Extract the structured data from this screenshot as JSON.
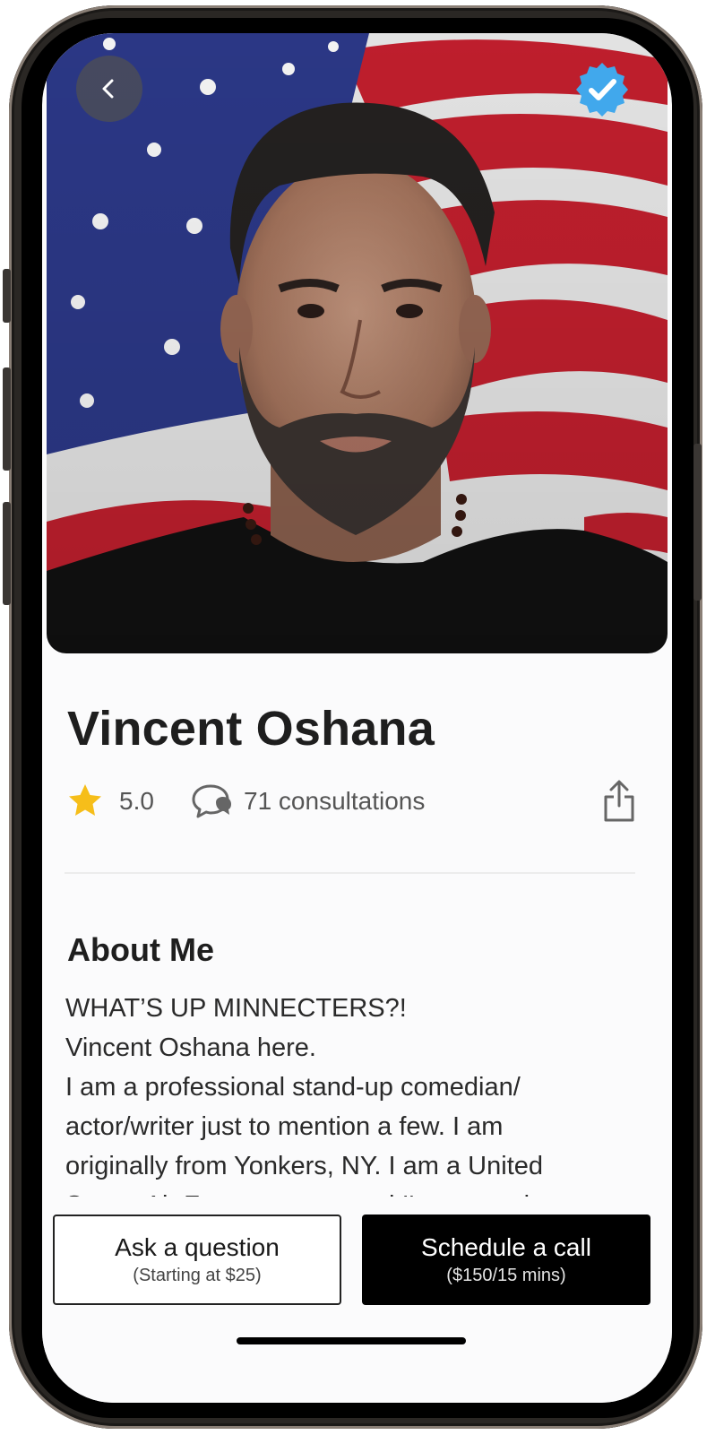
{
  "profile": {
    "name": "Vincent Oshana",
    "rating": "5.0",
    "consultations": "71 consultations",
    "verified": true
  },
  "about": {
    "title": "About Me",
    "body": "WHAT’S UP MINNECTERS?!\nVincent Oshana here.\nI am a professional stand-up comedian/\nactor/writer just to mention a few. I am\noriginally from Yonkers, NY. I am a United\nStates Air Force veteran and I'm currently"
  },
  "actions": {
    "ask": {
      "label": "Ask a question",
      "sub": "(Starting at $25)"
    },
    "schedule": {
      "label": "Schedule a call",
      "sub": "($150/15 mins)"
    }
  },
  "icons": {
    "back": "chevron-left-icon",
    "verified": "verified-badge-icon",
    "rating": "star-icon",
    "consultations": "chat-bubbles-icon",
    "share": "share-icon"
  },
  "colors": {
    "star": "#F6BE1A",
    "verified": "#41A8EC",
    "primary_button": "#000000",
    "flag_red": "#C8202F",
    "flag_blue": "#2D3A8C"
  }
}
